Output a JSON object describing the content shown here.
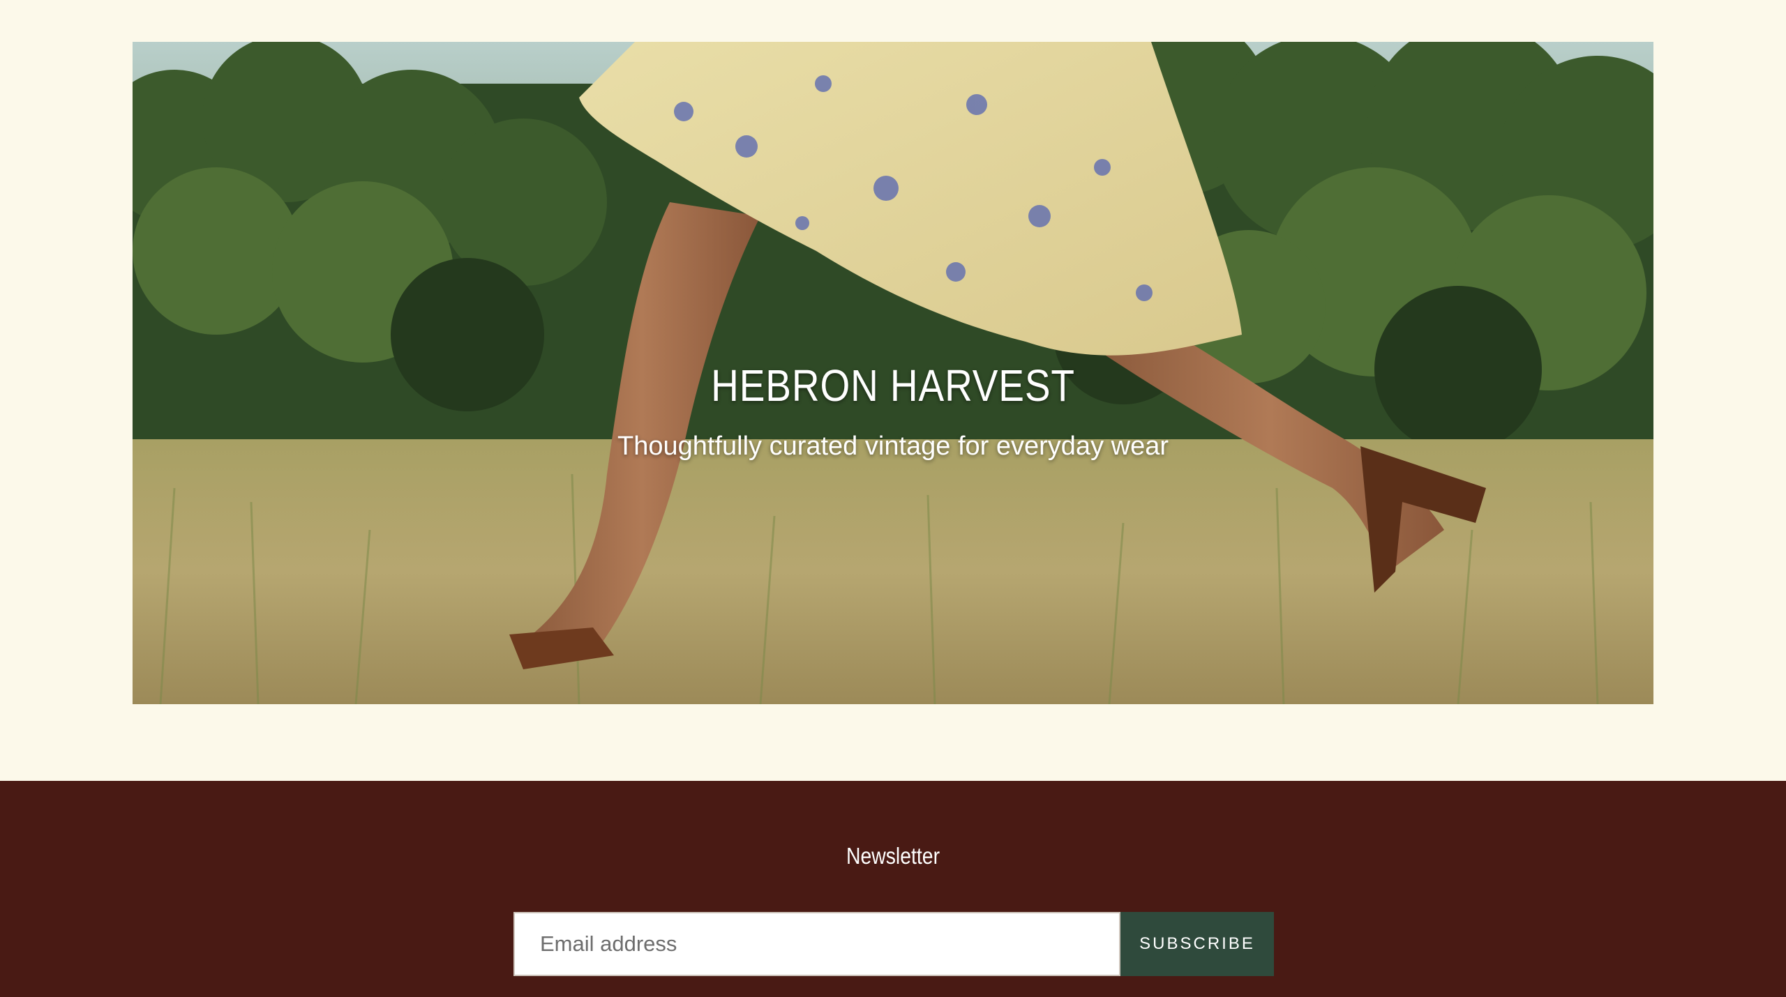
{
  "hero": {
    "title": "HEBRON HARVEST",
    "subtitle": "Thoughtfully curated vintage for everyday wear",
    "image": "hero-photo-dress-field"
  },
  "newsletter": {
    "title": "Newsletter",
    "email_placeholder": "Email address",
    "email_value": "",
    "subscribe_label": "SUBSCRIBE"
  },
  "colors": {
    "page_background": "#fcf9ea",
    "footer_background": "#491a14",
    "button_background": "#2f4a3c",
    "text_light": "#ffffff"
  }
}
